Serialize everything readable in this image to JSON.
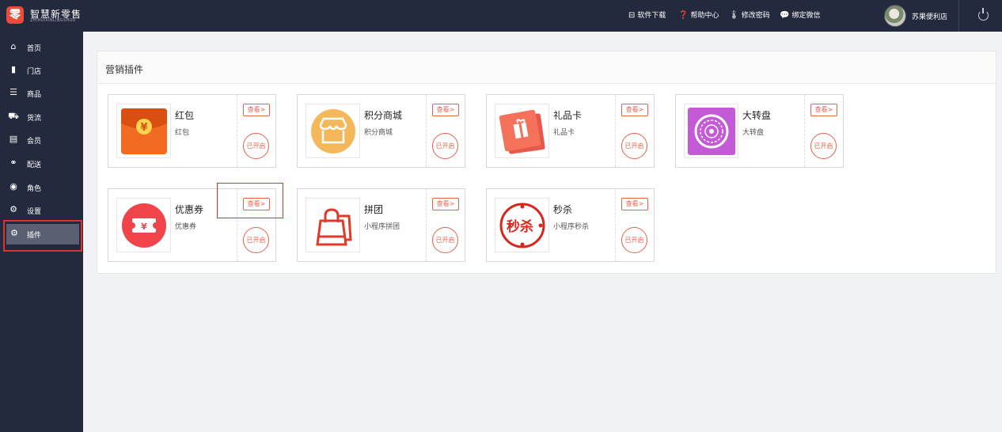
{
  "header": {
    "logo_char": "零",
    "app_title": "智慧新零售",
    "app_subtitle": "ZHIHUIXINLINGSHOU",
    "links": [
      {
        "icon": "download-icon",
        "label": "软件下载"
      },
      {
        "icon": "help-icon",
        "label": "帮助中心"
      },
      {
        "icon": "thermometer-icon",
        "label": "修改密码"
      },
      {
        "icon": "wechat-icon",
        "label": "绑定微信"
      }
    ],
    "username": "苏果便利店"
  },
  "sidebar": {
    "items": [
      {
        "icon": "home-icon",
        "label": "首页"
      },
      {
        "icon": "store-icon",
        "label": "门店"
      },
      {
        "icon": "list-icon",
        "label": "商品"
      },
      {
        "icon": "truck-icon",
        "label": "货流"
      },
      {
        "icon": "member-card-icon",
        "label": "会员"
      },
      {
        "icon": "bike-icon",
        "label": "配送"
      },
      {
        "icon": "user-circle-icon",
        "label": "角色"
      },
      {
        "icon": "gear-icon",
        "label": "设置"
      },
      {
        "icon": "gears-icon",
        "label": "插件"
      }
    ],
    "active": "插件"
  },
  "main": {
    "panel_title": "营销插件",
    "view_label": "查看>",
    "status_label": "已开启",
    "plugins": [
      {
        "name": "红包",
        "desc": "红包",
        "icon": "red-envelope-icon",
        "color": "#f26b23"
      },
      {
        "name": "积分商城",
        "desc": "积分商城",
        "icon": "points-mall-icon",
        "color": "#f4b85a"
      },
      {
        "name": "礼品卡",
        "desc": "礼品卡",
        "icon": "gift-card-icon",
        "color": "#f4715a"
      },
      {
        "name": "大转盘",
        "desc": "大转盘",
        "icon": "wheel-icon",
        "color": "#c45ad6"
      },
      {
        "name": "优惠券",
        "desc": "优惠券",
        "icon": "coupon-icon",
        "color": "#f0444a"
      },
      {
        "name": "拼团",
        "desc": "小程序拼团",
        "icon": "shopping-bag-icon",
        "color": "#e03a2a"
      },
      {
        "name": "秒杀",
        "desc": "小程序秒杀",
        "icon": "flash-sale-icon",
        "color": "#d9261c"
      }
    ]
  },
  "flash_sale_art_text": "秒杀"
}
